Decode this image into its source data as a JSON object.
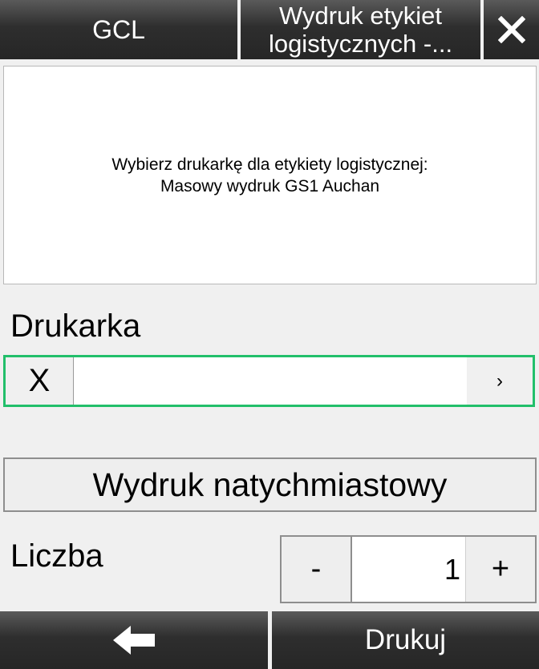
{
  "topbar": {
    "app_label": "GCL",
    "title_line1": "Wydruk etykiet",
    "title_line2": "logistycznych  -...",
    "close_icon": "close-icon"
  },
  "message": {
    "line1": "Wybierz drukarkę dla etykiety logistycznej:",
    "line2": "Masowy wydruk GS1 Auchan"
  },
  "printer": {
    "label": "Drukarka",
    "clear_label": "X",
    "value": "",
    "chevron": "›"
  },
  "immediate_print_label": "Wydruk natychmiastowy",
  "count": {
    "label": "Liczba",
    "minus": "-",
    "value": "1",
    "plus": "+"
  },
  "bottombar": {
    "back_icon": "arrow-left-icon",
    "print_label": "Drukuj"
  }
}
